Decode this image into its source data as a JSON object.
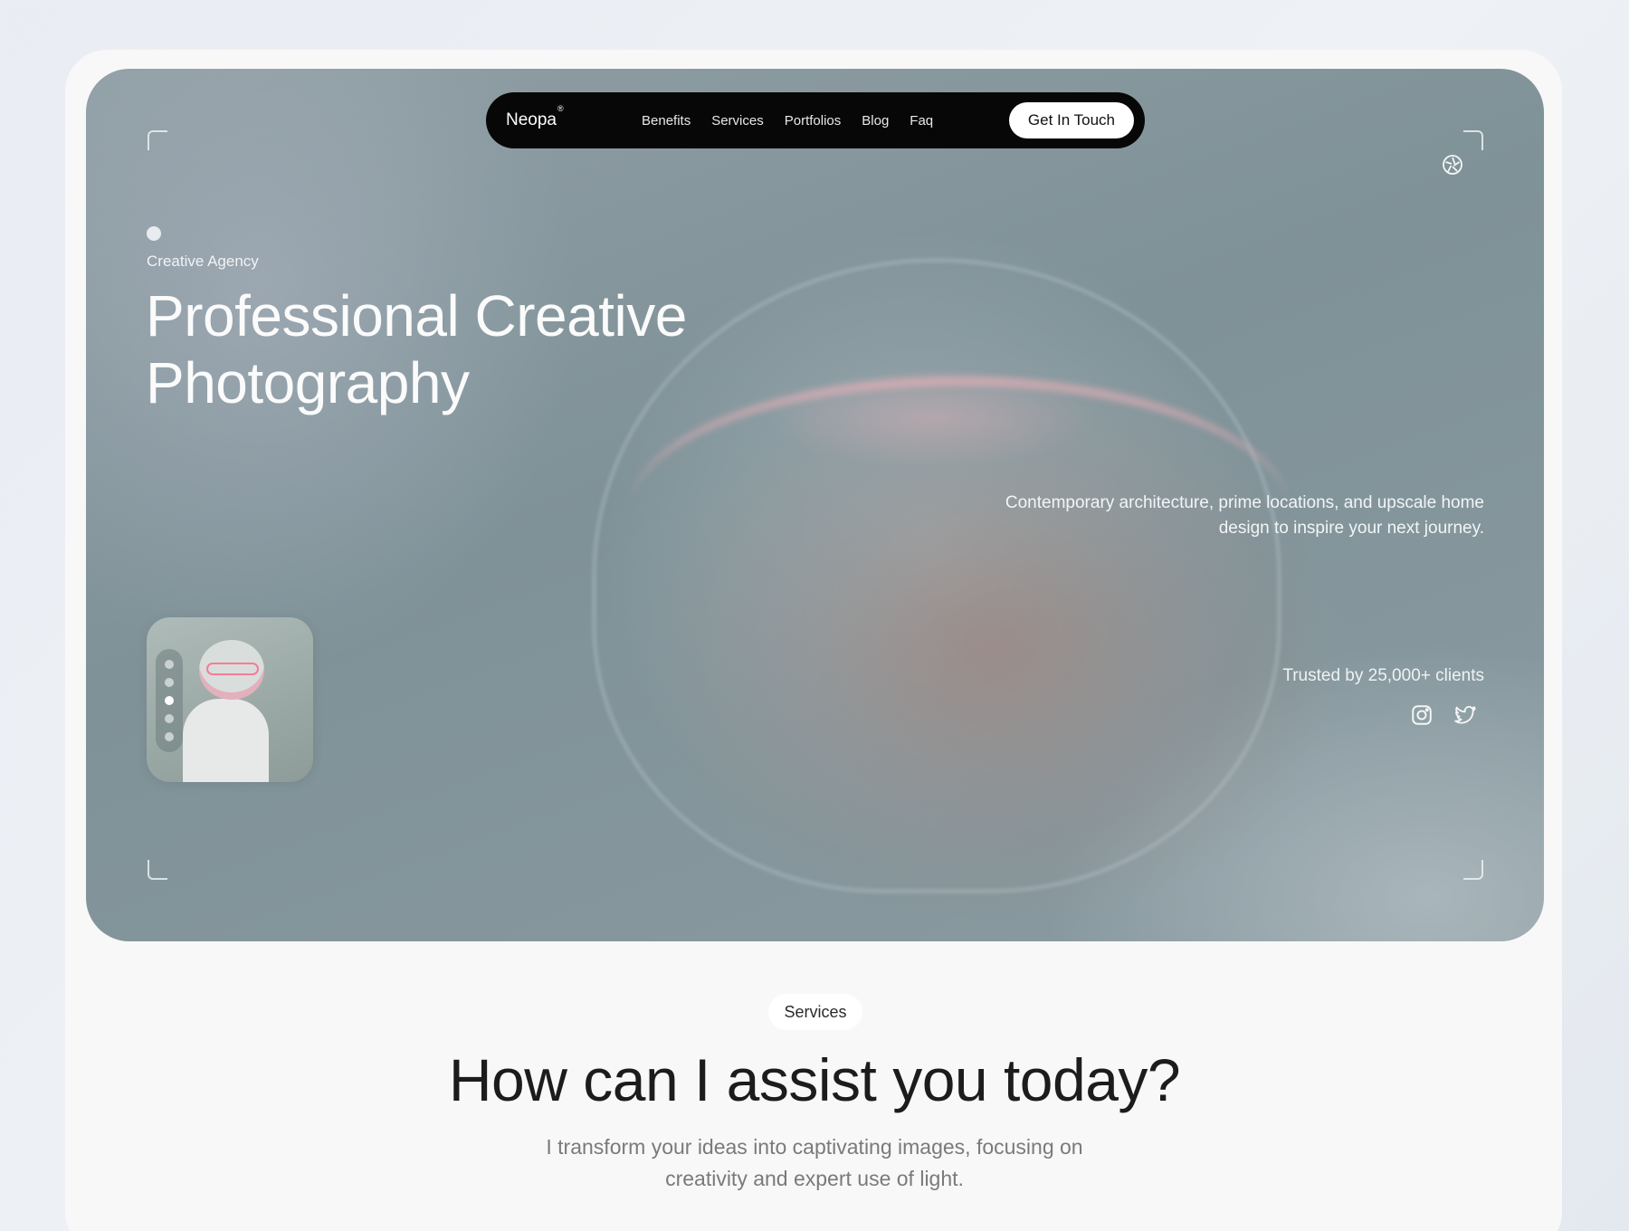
{
  "nav": {
    "brand": "Neopa",
    "brand_mark": "®",
    "links": [
      "Benefits",
      "Services",
      "Portfolios",
      "Blog",
      "Faq"
    ],
    "cta_label": "Get In Touch"
  },
  "hero": {
    "eyebrow": "Creative Agency",
    "headline_line1": "Professional Creative",
    "headline_line2": "Photography",
    "description": "Contemporary architecture, prime locations, and upscale home design to inspire your next journey.",
    "trust_text": "Trusted by 25,000+ clients",
    "social_icons": [
      "instagram-icon",
      "twitter-icon"
    ],
    "corner_icon": "aperture-icon",
    "slider": {
      "total": 5,
      "active_index": 2
    }
  },
  "services": {
    "tag": "Services",
    "title": "How can  I assist you today?",
    "subtitle": "I transform your ideas into captivating images, focusing on creativity and expert use of light."
  },
  "colors": {
    "nav_bg": "#070707",
    "hero_bg": "#8a9ba1",
    "accent_pink": "#ff5a82",
    "page_bg": "#f8f8f8"
  }
}
